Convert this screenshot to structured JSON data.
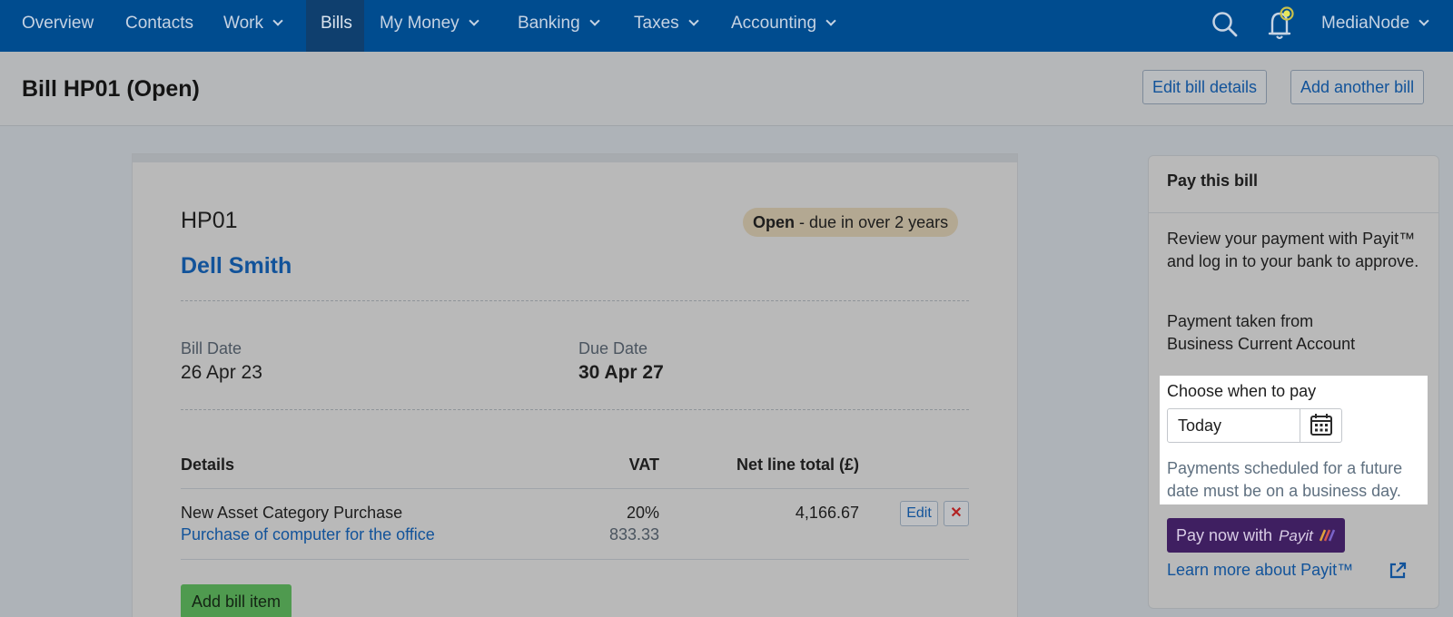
{
  "nav": {
    "items": [
      {
        "label": "Overview",
        "dropdown": false
      },
      {
        "label": "Contacts",
        "dropdown": false
      },
      {
        "label": "Work",
        "dropdown": true
      },
      {
        "label": "Bills",
        "dropdown": false,
        "active": true
      },
      {
        "label": "My Money",
        "dropdown": true
      },
      {
        "label": "Banking",
        "dropdown": true
      },
      {
        "label": "Taxes",
        "dropdown": true
      },
      {
        "label": "Accounting",
        "dropdown": true
      }
    ],
    "account_label": "MediaNode",
    "notification_dot_color": "#e6e65a"
  },
  "header": {
    "title": "Bill HP01 (Open)",
    "edit_button": "Edit bill details",
    "add_button": "Add another bill"
  },
  "bill": {
    "reference": "HP01",
    "status": "Open",
    "status_detail": "- due in over 2 years",
    "contact": "Dell Smith",
    "bill_date_label": "Bill Date",
    "bill_date": "26 Apr 23",
    "due_date_label": "Due Date",
    "due_date": "30 Apr 27",
    "table": {
      "headers": {
        "details": "Details",
        "vat": "VAT",
        "net": "Net line total (£)"
      },
      "rows": [
        {
          "category": "New Asset Category Purchase",
          "description": "Purchase of computer for the office",
          "vat_rate": "20%",
          "vat_amount": "833.33",
          "net_total": "4,166.67",
          "edit_label": "Edit",
          "delete_glyph": "✕"
        }
      ]
    },
    "add_item_button": "Add bill item"
  },
  "pay_panel": {
    "title": "Pay this bill",
    "intro": "Review your payment with Payit™ and log in to your bank to approve.",
    "taken_from_label": "Payment taken from",
    "taken_from_account": "Business Current Account",
    "choose_label": "Choose when to pay",
    "date_value": "Today",
    "note": "Payments scheduled for a future date must be on a business day.",
    "pay_button": "Pay now with",
    "pay_brand": "Payit",
    "learn_more": "Learn more about Payit™"
  },
  "colors": {
    "nav_bg": "#004c8f",
    "link": "#12539a",
    "pay_button": "#3f1f61",
    "add_item_button": "#4f9a4f",
    "status_pill": "#b3a892",
    "delete_icon": "#b22222"
  }
}
